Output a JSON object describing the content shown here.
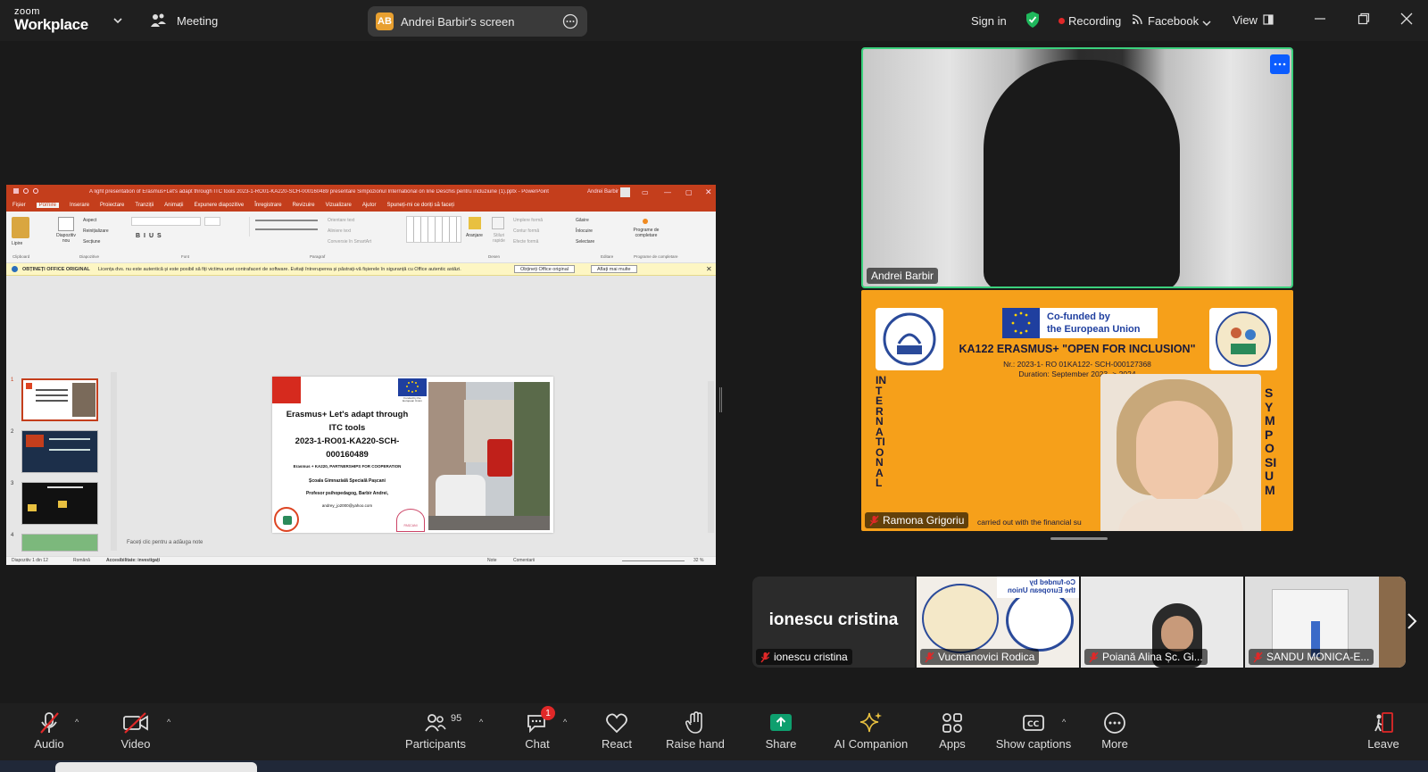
{
  "topbar": {
    "logo_line1": "zoom",
    "logo_line2": "Workplace",
    "meeting_label": "Meeting",
    "screen_badge": "AB",
    "screen_label": "Andrei Barbir's screen",
    "sign_in": "Sign in",
    "recording": "Recording",
    "facebook": "Facebook",
    "view": "View"
  },
  "ppt": {
    "title": "A light presentation of Erasmus+Let's adapt through ITC tools 2023-1-RO01-KA220-SCH-000160489 presentare Simpozionul International on line Deschis pentru incluziune (1).pptx - PowerPoint",
    "user": "Andrei Barbir",
    "tabs": [
      "Fișier",
      "Pornire",
      "Inserare",
      "Proiectare",
      "Tranziții",
      "Animații",
      "Expunere diapozitive",
      "Înregistrare",
      "Revizuire",
      "Vizualizare",
      "Ajutor",
      "Spuneți-mi ce doriți să faceți"
    ],
    "groups": [
      "Clipboard",
      "Diapozitive",
      "Font",
      "Paragraf",
      "Desen",
      "Editare",
      "Programe de completare"
    ],
    "ribbon_labels": [
      "Lipire",
      "Diapozitiv nou",
      "Aspect",
      "Reinițializare",
      "Secțiune",
      "Orientare text",
      "Aliniere text",
      "Conversie în SmartArt",
      "Aranjare",
      "Stiluri rapide",
      "Umplere formă",
      "Contur formă",
      "Efecte formă",
      "Găsire",
      "Înlocuire",
      "Selectare",
      "Programe de completare"
    ],
    "warning_title": "OBȚINEȚI OFFICE ORIGINAL",
    "warning_text": "Licența dvs. nu este autentică și este posibil să fiți victima unei contrafaceri de software. Evitați întreruperea și păstrați-vă fișierele în siguranță cu Office autentic astăzi.",
    "warning_btn1": "Obțineți Office original",
    "warning_btn2": "Aflați mai multe",
    "notes_placeholder": "Faceți clic pentru a adăuga note",
    "status_left": "Diapozitiv 1 din 12",
    "status_lang": "Română",
    "status_access": "Accesibilitate: investigați",
    "status_notes": "Note",
    "status_comments": "Comentarii",
    "zoom": "32 %",
    "thumb_numbers": [
      "1",
      "2",
      "3",
      "4"
    ],
    "slide": {
      "eu_text": "Funded by the European Union",
      "line1": "Erasmus+ Let's adapt through",
      "line2": "ITC tools",
      "line3": "2023-1-RO01-KA220-SCH-",
      "line4": "000160489",
      "line5": "Erasmus + KA220, PARTNERSHIPS FOR COOPERATION",
      "line6": "Școala Gimnazială Specială Pașcani",
      "line7": "Profesor psihopedagog, Barbir Andrei,",
      "line8": "andrey_jo2000@yahoo.com",
      "stamp": "PAȘCANI"
    }
  },
  "tiles": {
    "main_name": "Andrei Barbir",
    "slide_name": "Ramona Grigoriu",
    "eu_cofunded_1": "Co-funded by",
    "eu_cofunded_2": "the European Union",
    "project_title": "KA122 ERASMUS+ \"OPEN FOR INCLUSION\"",
    "project_nr": "Nr.: 2023-1- RO 01KA122- SCH-000127368",
    "duration": "Duration: September 2023 -> 2024",
    "vertical_left": "INTERNATIONAL",
    "vertical_right": "SYMPOSIUM",
    "financial": "carried out with the financial su"
  },
  "strip": [
    {
      "big": "ionescu cristina",
      "name": "ionescu cristina"
    },
    {
      "name": "Vucmanovici Rodica",
      "mirror1": "Co-funded by",
      "mirror2": "the European Union"
    },
    {
      "name": "Poiană Alina Șc. Gi..."
    },
    {
      "name": "SANDU MONICA-E..."
    }
  ],
  "toolbar": {
    "audio": "Audio",
    "video": "Video",
    "participants": "Participants",
    "participants_count": "95",
    "chat": "Chat",
    "chat_badge": "1",
    "react": "React",
    "raise_hand": "Raise hand",
    "share": "Share",
    "ai_companion": "AI Companion",
    "apps": "Apps",
    "show_captions": "Show captions",
    "more": "More",
    "leave": "Leave"
  },
  "colors": {
    "share_green": "#0e9f6e",
    "muted_red": "#e02828",
    "active_speaker": "#3bd17d",
    "ppt_red": "#c43e1c",
    "slide_orange": "#f6a01a"
  }
}
